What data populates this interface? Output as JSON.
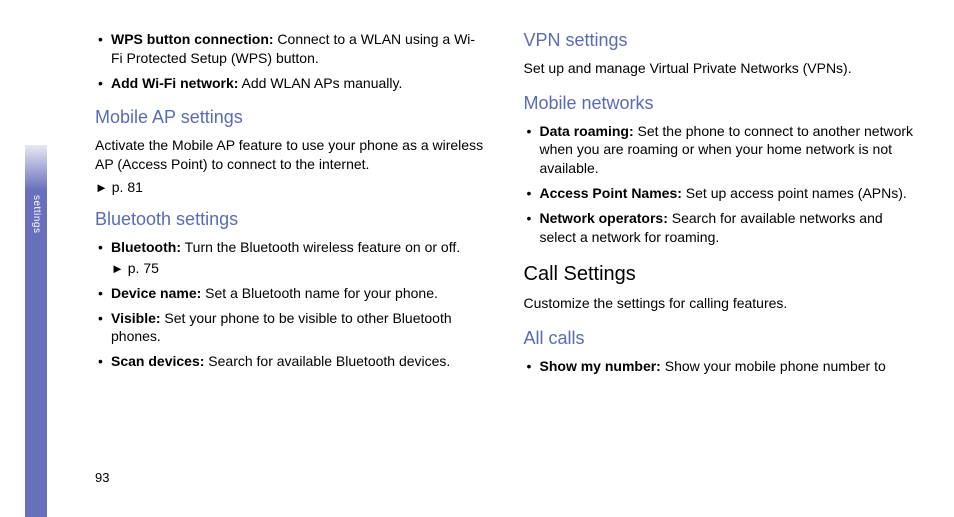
{
  "side_label": "settings",
  "page_number": "93",
  "arrow_glyph": "►",
  "col1": {
    "wifi_items": [
      {
        "term": "WPS button connection:",
        "desc": " Connect to a WLAN using a Wi-Fi Protected Setup (WPS) button."
      },
      {
        "term": "Add Wi-Fi network:",
        "desc": " Add WLAN APs manually."
      }
    ],
    "mobile_ap_heading": "Mobile AP settings",
    "mobile_ap_para": "Activate the Mobile AP feature to use your phone as a wireless AP (Access Point) to connect to the internet.",
    "mobile_ap_ref": "  p. 81",
    "bt_heading": "Bluetooth settings",
    "bt_items": [
      {
        "term": "Bluetooth:",
        "desc": " Turn the Bluetooth wireless feature on or off.",
        "ref": "  p. 75"
      },
      {
        "term": "Device name:",
        "desc": " Set a Bluetooth name for your phone."
      },
      {
        "term": "Visible:",
        "desc": " Set your phone to be visible to other Bluetooth phones."
      },
      {
        "term": "Scan devices:",
        "desc": " Search for available Bluetooth devices."
      }
    ]
  },
  "col2": {
    "vpn_heading": "VPN settings",
    "vpn_para": "Set up and manage Virtual Private Networks (VPNs).",
    "mobnet_heading": "Mobile networks",
    "mobnet_items": [
      {
        "term": "Data roaming:",
        "desc": " Set the phone to connect to another network when you are roaming or when your home network is not available."
      },
      {
        "term": "Access Point Names:",
        "desc": " Set up access point names (APNs)."
      },
      {
        "term": "Network operators:",
        "desc": " Search for available networks and select a network for roaming."
      }
    ],
    "call_heading": "Call Settings",
    "call_para": "Customize the settings for calling features.",
    "allcalls_heading": "All calls",
    "allcalls_items": [
      {
        "term": "Show my number:",
        "desc": " Show your mobile phone number to"
      }
    ]
  }
}
